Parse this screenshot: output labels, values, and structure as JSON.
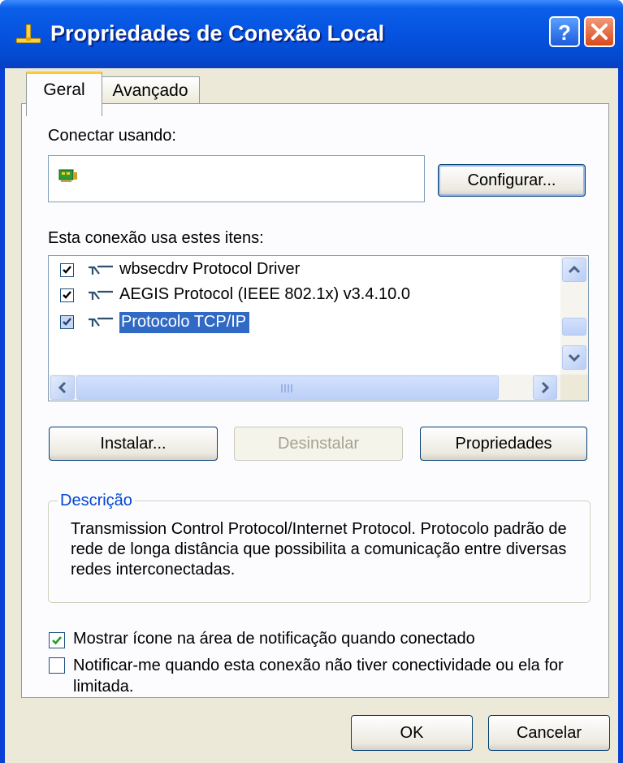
{
  "window": {
    "title": "Propriedades de Conexão Local"
  },
  "titlebar": {
    "help_icon": "help-icon",
    "close_icon": "close-icon"
  },
  "tabs": [
    {
      "label": "Geral",
      "active": true
    },
    {
      "label": "Avançado",
      "active": false
    }
  ],
  "connect": {
    "label": "Conectar usando:",
    "adapter_icon": "network-adapter-icon",
    "configure_label": "Configurar..."
  },
  "items": {
    "label": "Esta conexão usa estes itens:",
    "list": [
      {
        "label": "wbsecdrv Protocol Driver",
        "checked": true,
        "selected": false,
        "icon": "protocol-icon"
      },
      {
        "label": "AEGIS Protocol (IEEE 802.1x) v3.4.10.0",
        "checked": true,
        "selected": false,
        "icon": "protocol-icon"
      },
      {
        "label": "Protocolo TCP/IP",
        "checked": true,
        "selected": true,
        "icon": "protocol-icon"
      }
    ]
  },
  "buttons": {
    "install": "Instalar...",
    "uninstall": "Desinstalar",
    "properties": "Propriedades"
  },
  "description": {
    "title": "Descrição",
    "text": "Transmission Control Protocol/Internet Protocol. Protocolo padrão de rede de longa distância que possibilita a comunicação entre diversas redes interconectadas."
  },
  "options": {
    "show_icon": {
      "label": "Mostrar ícone na área de notificação quando conectado",
      "checked": true
    },
    "notify": {
      "label": "Notificar-me quando esta conexão não tiver conectividade ou ela for limitada.",
      "checked": false
    }
  },
  "dialog": {
    "ok": "OK",
    "cancel": "Cancelar"
  },
  "colors": {
    "titlebar": "#0553e0",
    "selection": "#316ac5",
    "group_title": "#0046d5",
    "face": "#ece9d8"
  }
}
